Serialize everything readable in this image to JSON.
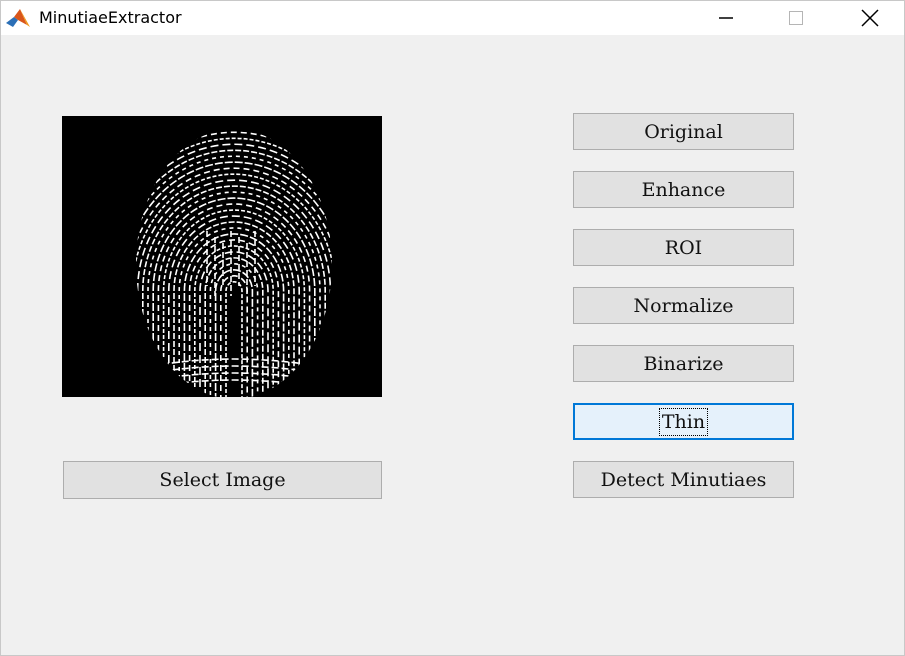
{
  "window": {
    "title": "MinutiaeExtractor",
    "controls": {
      "minimize": "minimize-icon",
      "maximize": "maximize-icon",
      "close": "close-icon"
    }
  },
  "image_panel": {
    "content": "fingerprint-image",
    "background_color": "#000000"
  },
  "buttons": {
    "select_image": "Select Image",
    "original": "Original",
    "enhance": "Enhance",
    "roi": "ROI",
    "normalize": "Normalize",
    "binarize": "Binarize",
    "thin": "Thin",
    "detect_minutiaes": "Detect Minutiaes"
  },
  "focused_button": "Thin",
  "colors": {
    "window_bg": "#f0f0f0",
    "button_bg": "#e1e1e1",
    "focus_border": "#0078d7",
    "focus_bg": "#e5f1fb"
  }
}
